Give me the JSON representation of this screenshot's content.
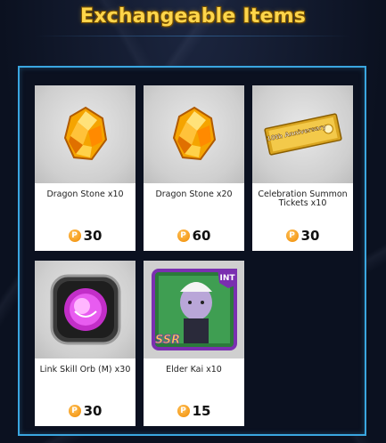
{
  "header": {
    "title": "Exchangeable Items"
  },
  "currency_symbol": "P",
  "items": [
    {
      "name": "Dragon Stone x10",
      "price": "30",
      "icon": "dragon-stone-icon"
    },
    {
      "name": "Dragon Stone x20",
      "price": "60",
      "icon": "dragon-stone-icon"
    },
    {
      "name": "Celebration Summon Tickets x10",
      "price": "30",
      "icon": "summon-ticket-icon",
      "ticket_text": "10th Anniversary"
    },
    {
      "name": "Link Skill Orb (M) x30",
      "price": "30",
      "icon": "link-skill-orb-icon"
    },
    {
      "name": "Elder Kai x10",
      "price": "15",
      "icon": "elder-kai-card-icon",
      "badge_rarity": "SSR",
      "badge_type": "INT"
    }
  ]
}
